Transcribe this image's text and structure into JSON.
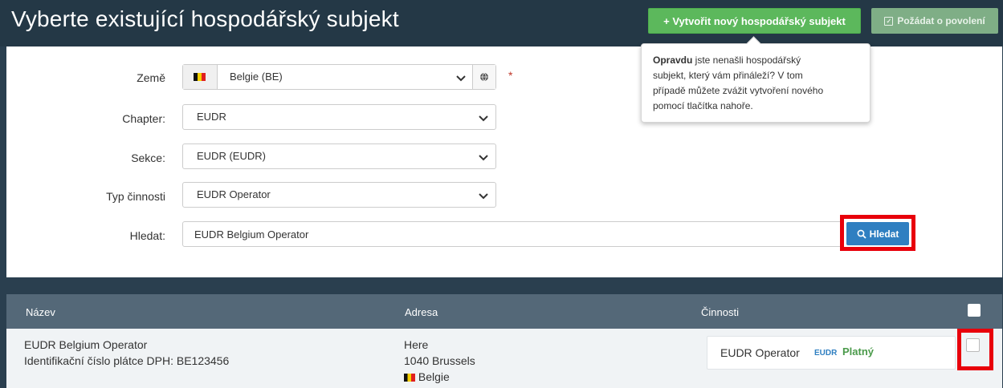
{
  "header": {
    "title": "Vyberte existující hospodářský subjekt",
    "create_button": "+ Vytvořit nový hospodářský subjekt",
    "request_button": "Požádat o povolení"
  },
  "form": {
    "country_label": "Země",
    "country_value": "Belgie (BE)",
    "chapter_label": "Chapter:",
    "chapter_value": "EUDR",
    "section_label": "Sekce:",
    "section_value": "EUDR (EUDR)",
    "activity_label": "Typ činnosti",
    "activity_value": "EUDR Operator",
    "search_label": "Hledat:",
    "search_value": "EUDR Belgium Operator",
    "search_button": "Hledat",
    "required_mark": "*"
  },
  "tooltip": {
    "bold": "Opravdu",
    "line1": " jste nenašli hospodářský",
    "line2": "subjekt, který vám přináleží? V tom",
    "line3": "případě můžete zvážit vytvoření nového",
    "line4": "pomocí tlačítka nahoře."
  },
  "table": {
    "col_name": "Název",
    "col_address": "Adresa",
    "col_activities": "Činnosti",
    "rows": [
      {
        "name": "EUDR Belgium Operator",
        "vat": "Identifikační číslo plátce DPH: BE123456",
        "addr1": "Here",
        "addr2": "1040 Brussels",
        "country": "Belgie",
        "activity": "EUDR Operator",
        "activity_tag": "EUDR",
        "status": "Platný"
      }
    ]
  },
  "colors": {
    "header_bg": "#243846",
    "green": "#5cb85c",
    "blue": "#2f7fc1",
    "highlight_red": "#e8000b"
  }
}
